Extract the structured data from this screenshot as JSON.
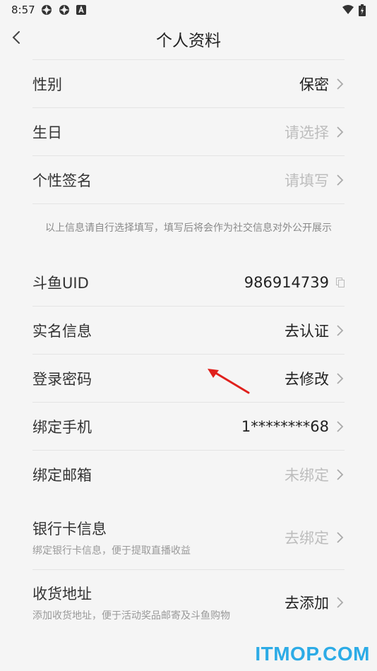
{
  "status_bar": {
    "time": "8:57",
    "icons": [
      "gear-icon",
      "gear-icon",
      "text-a-icon",
      "wifi-icon",
      "battery-charging-icon"
    ]
  },
  "header": {
    "title": "个人资料"
  },
  "section1": {
    "rows": [
      {
        "label": "性别",
        "value": "保密",
        "muted": false
      },
      {
        "label": "生日",
        "value": "请选择",
        "muted": true
      },
      {
        "label": "个性签名",
        "value": "请填写",
        "muted": true
      }
    ],
    "note": "以上信息请自行选择填写，填写后将会作为社交信息对外公开展示"
  },
  "section2": {
    "rows": [
      {
        "label": "斗鱼UID",
        "value": "986914739"
      },
      {
        "label": "实名信息",
        "value": "去认证"
      },
      {
        "label": "登录密码",
        "value": "去修改"
      },
      {
        "label": "绑定手机",
        "value": "1********68"
      },
      {
        "label": "绑定邮箱",
        "value": "未绑定"
      }
    ]
  },
  "section3": {
    "rows": [
      {
        "label": "银行卡信息",
        "sub": "绑定银行卡信息，便于提取直播收益",
        "value": "去绑定"
      },
      {
        "label": "收货地址",
        "sub": "添加收货地址，便于活动奖品邮寄及斗鱼购物",
        "value": "去添加"
      }
    ]
  },
  "watermark": "ITMOP.COM",
  "colors": {
    "accent": "#2cabe6",
    "annotation": "#e0201c",
    "muted": "#bdbdbd"
  }
}
